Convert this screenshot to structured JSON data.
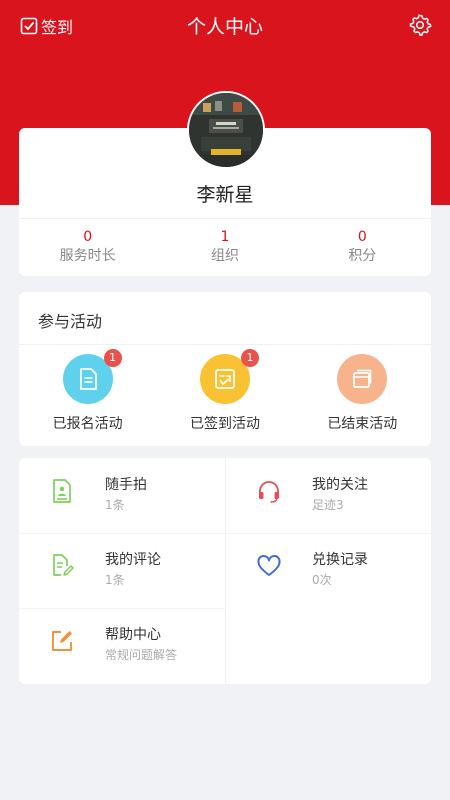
{
  "header": {
    "checkin_label": "签到",
    "title": "个人中心",
    "bg_color": "#d9141d"
  },
  "profile": {
    "name": "李新星",
    "stats": [
      {
        "value": "0",
        "label": "服务时长"
      },
      {
        "value": "1",
        "label": "组织"
      },
      {
        "value": "0",
        "label": "积分"
      }
    ]
  },
  "activities": {
    "title": "参与活动",
    "items": [
      {
        "label": "已报名活动",
        "badge": "1",
        "color": "#5fd1ec",
        "icon": "document-icon"
      },
      {
        "label": "已签到活动",
        "badge": "1",
        "color": "#f8c232",
        "icon": "checkin-doc-icon"
      },
      {
        "label": "已结束活动",
        "color": "#f7b48c",
        "icon": "stack-icon"
      }
    ]
  },
  "menu": {
    "items": [
      {
        "title": "随手拍",
        "subtitle": "1条",
        "icon": "photo-doc-icon"
      },
      {
        "title": "我的关注",
        "subtitle": "足迹3",
        "icon": "headset-icon"
      },
      {
        "title": "我的评论",
        "subtitle": "1条",
        "icon": "edit-doc-icon"
      },
      {
        "title": "兑换记录",
        "subtitle": "0次",
        "icon": "heart-icon"
      },
      {
        "title": "帮助中心",
        "subtitle": "常规问题解答",
        "icon": "help-edit-icon"
      }
    ]
  }
}
